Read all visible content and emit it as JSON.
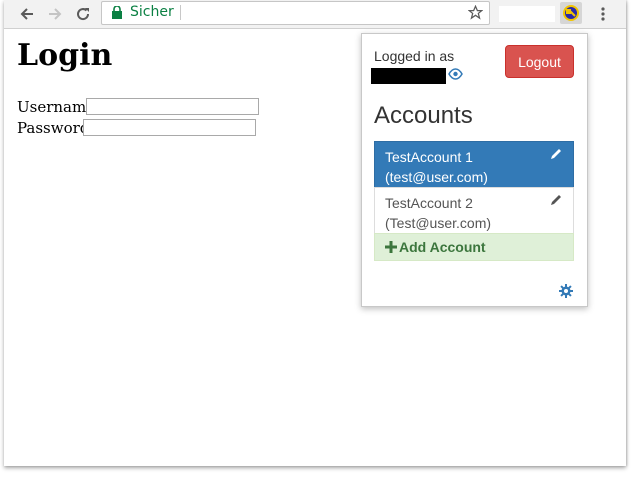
{
  "browser": {
    "secure_label": "Sicher",
    "icons": {
      "back": "back-arrow-icon",
      "forward": "forward-arrow-icon",
      "reload": "reload-icon",
      "lock": "lock-icon",
      "star": "star-icon",
      "extension": "extension-key-icon",
      "menu": "kebab-menu-icon"
    }
  },
  "page": {
    "title": "Login",
    "username_label": "Username:",
    "password_label": "Password:",
    "username_value": "",
    "password_value": ""
  },
  "popup": {
    "logged_in_label": "Logged in as",
    "logout_label": "Logout",
    "accounts_heading": "Accounts",
    "accounts": [
      {
        "name": "TestAccount 1",
        "email": "(test@user.com)",
        "active": true
      },
      {
        "name": "TestAccount 2",
        "email": "(Test@user.com)",
        "active": false
      }
    ],
    "add_account_label": "Add Account",
    "colors": {
      "logout_bg": "#d9534f",
      "active_bg": "#337ab7",
      "add_bg": "#dff0d8",
      "add_text": "#3c763d",
      "link_blue": "#337ab7"
    }
  }
}
